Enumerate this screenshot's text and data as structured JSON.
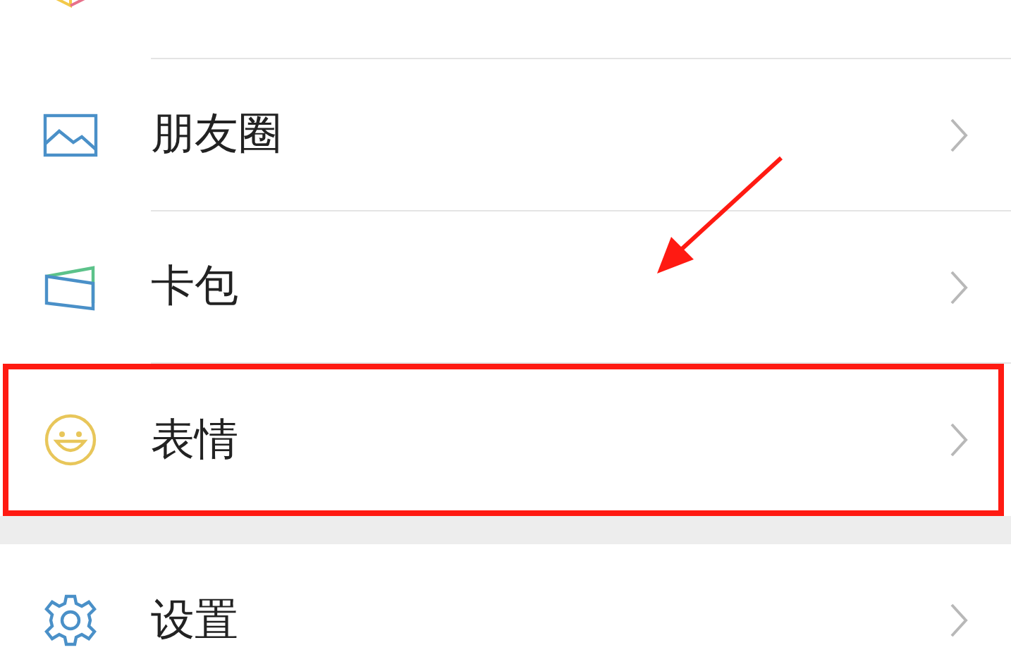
{
  "sections": [
    {
      "items": [
        {
          "kind": "favorites",
          "highlighted": false
        },
        {
          "kind": "moments",
          "label": "朋友圈",
          "highlighted": false
        },
        {
          "kind": "cards",
          "label": "卡包",
          "highlighted": false
        },
        {
          "kind": "stickers",
          "label": "表情",
          "highlighted": true
        }
      ]
    },
    {
      "items": [
        {
          "kind": "settings",
          "label": "设置",
          "highlighted": false
        }
      ]
    }
  ]
}
